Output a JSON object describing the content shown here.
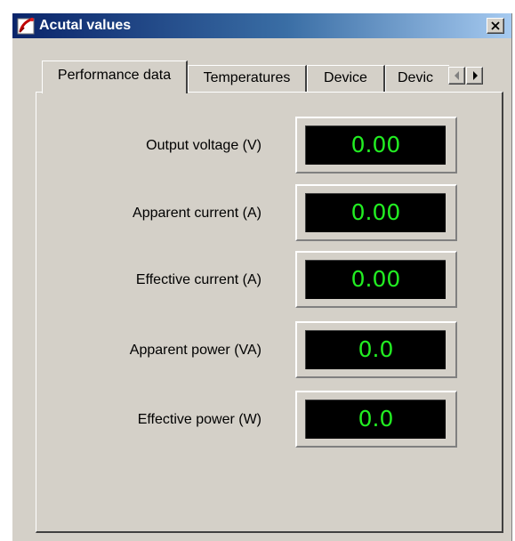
{
  "window": {
    "title": "Acutal values",
    "icon": "app-icon",
    "close_glyph": "×"
  },
  "tabs": [
    {
      "label": "Performance data",
      "active": true
    },
    {
      "label": "Temperatures",
      "active": false
    },
    {
      "label": "Device",
      "active": false
    },
    {
      "label": "Devic",
      "active": false
    }
  ],
  "tab_scroll": {
    "left_icon": "chevron-left-icon",
    "right_icon": "chevron-right-icon"
  },
  "readings": [
    {
      "label": "Output voltage (V)",
      "value": "0.00"
    },
    {
      "label": "Apparent current (A)",
      "value": "0.00"
    },
    {
      "label": "Effective current (A)",
      "value": "0.00"
    },
    {
      "label": "Apparent power (VA)",
      "value": "0.0"
    },
    {
      "label": "Effective power (W)",
      "value": "0.0"
    }
  ],
  "colors": {
    "display_background": "#000000",
    "display_digits": "#22ee22",
    "window_face": "#d4d0c8",
    "title_gradient_start": "#0a246a",
    "title_gradient_end": "#a6caf0"
  }
}
